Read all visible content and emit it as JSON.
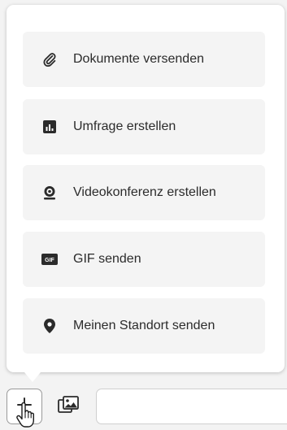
{
  "menu": {
    "items": [
      {
        "label": "Dokumente versenden",
        "icon": "paperclip-icon"
      },
      {
        "label": "Umfrage erstellen",
        "icon": "poll-icon"
      },
      {
        "label": "Videokonferenz erstellen",
        "icon": "webcam-icon"
      },
      {
        "label": "GIF senden",
        "icon": "gif-icon"
      },
      {
        "label": "Meinen Standort senden",
        "icon": "location-pin-icon"
      }
    ]
  },
  "composer": {
    "plus_icon": "plus-icon",
    "gallery_icon": "image-gallery-icon",
    "message_value": ""
  },
  "colors": {
    "popup_bg": "#ffffff",
    "item_bg": "#f4f4f4",
    "text": "#2b2b2b",
    "icon": "#2b2b2b"
  }
}
